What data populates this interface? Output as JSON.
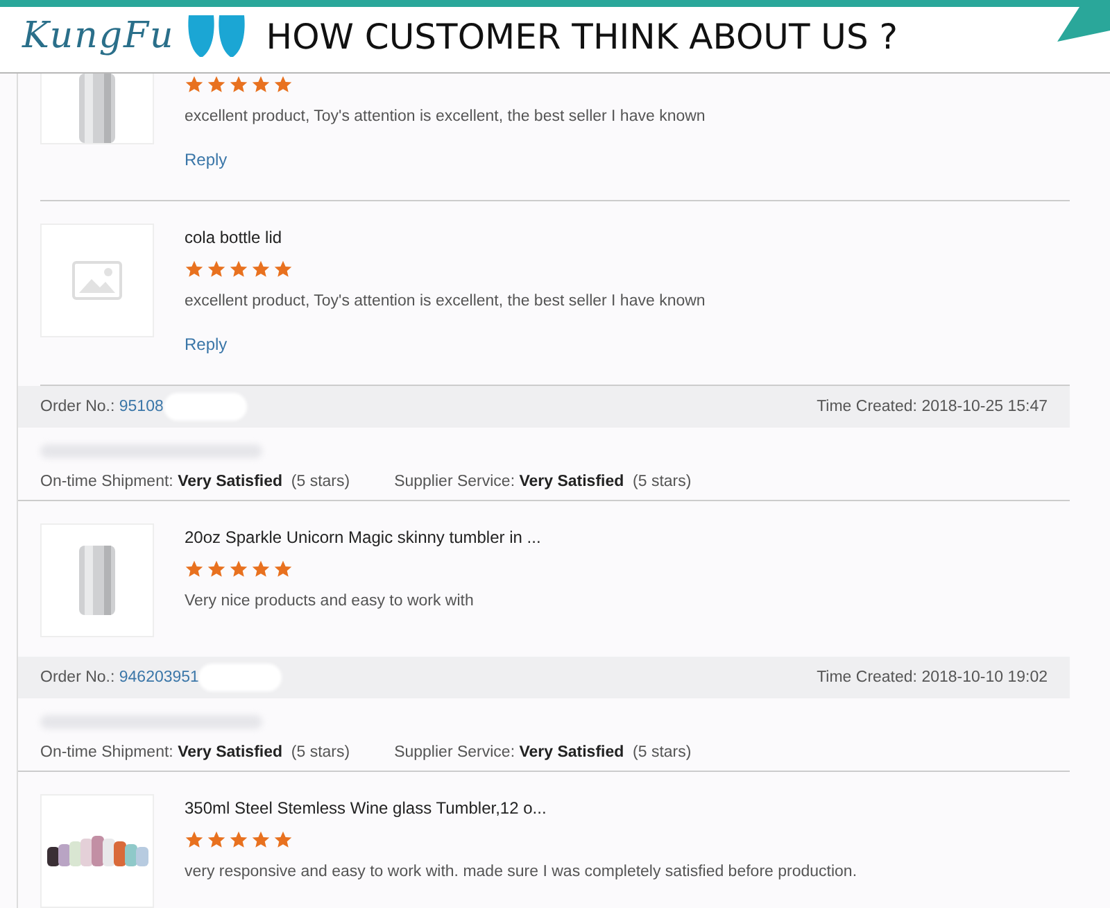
{
  "banner": {
    "logo": "KungFu",
    "headline": "HOW CUSTOMER THINK ABOUT US ?"
  },
  "feed": [
    {
      "kind": "product",
      "photo": true,
      "stars": 5,
      "comment": "excellent product, Toy's attention is excellent, the best seller I have known",
      "reply": "Reply"
    },
    {
      "kind": "product",
      "photo": false,
      "title": "cola bottle lid",
      "stars": 5,
      "comment": "excellent product, Toy's attention is excellent, the best seller I have known",
      "reply": "Reply"
    },
    {
      "kind": "order",
      "order_label": "Order No.:",
      "order_no": "95108",
      "time": "Time Created: 2018-10-25 15:47",
      "ratings": [
        {
          "label": "On-time Shipment:",
          "value": "Very Satisfied",
          "note": "(5 stars)"
        },
        {
          "label": "Supplier Service:",
          "value": "Very Satisfied",
          "note": "(5 stars)"
        }
      ]
    },
    {
      "kind": "product",
      "photo": true,
      "title": "20oz Sparkle Unicorn Magic skinny tumbler in ...",
      "stars": 5,
      "comment": "Very nice products and easy to work with"
    },
    {
      "kind": "order",
      "order_label": "Order No.:",
      "order_no": "946203951",
      "time": "Time Created: 2018-10-10 19:02",
      "ratings": [
        {
          "label": "On-time Shipment:",
          "value": "Very Satisfied",
          "note": "(5 stars)"
        },
        {
          "label": "Supplier Service:",
          "value": "Very Satisfied",
          "note": "(5 stars)"
        }
      ]
    },
    {
      "kind": "product",
      "photo": true,
      "title": "350ml Steel Stemless Wine glass Tumbler,12 o...",
      "stars": 5,
      "comment": "very responsive and easy to work with. made sure I was completely satisfied before production."
    }
  ]
}
